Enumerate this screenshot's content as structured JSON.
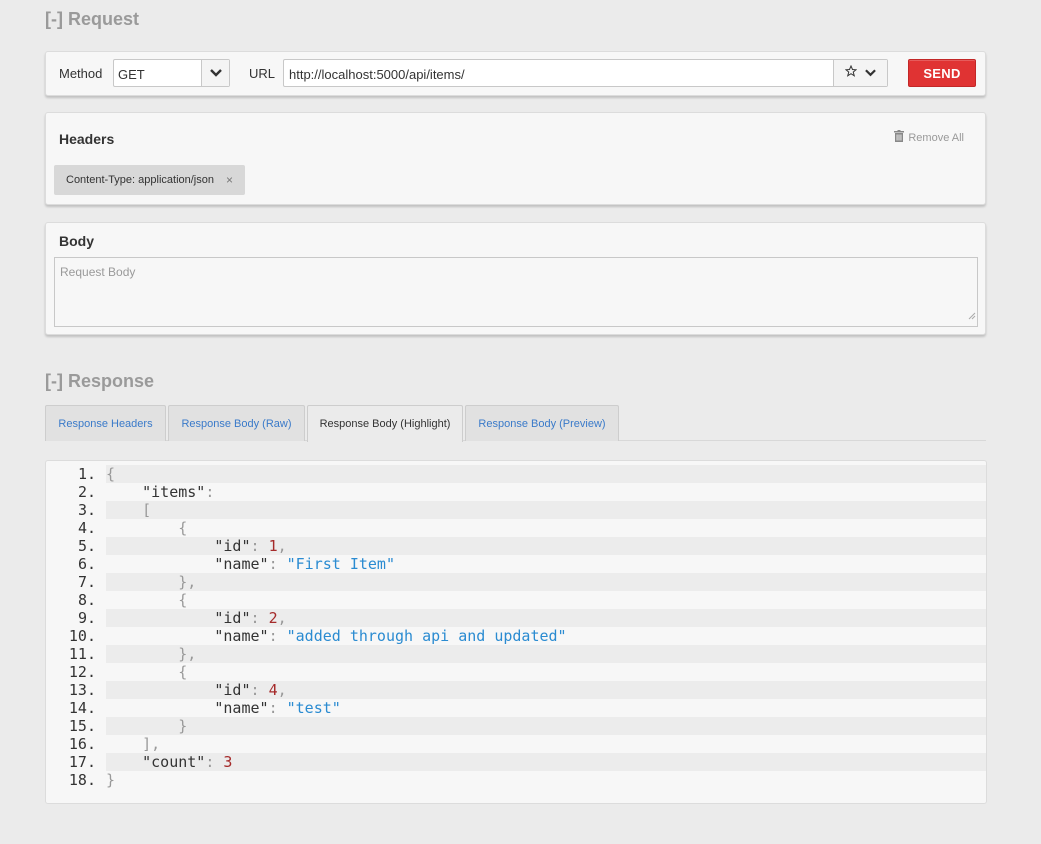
{
  "request": {
    "title": "[-] Request",
    "method_label": "Method",
    "method_value": "GET",
    "url_label": "URL",
    "url_value": "http://localhost:5000/api/items/",
    "send_label": "SEND",
    "headers": {
      "heading": "Headers",
      "remove_all": "Remove All",
      "items": [
        {
          "text": "Content-Type: application/json",
          "remove": "×"
        }
      ]
    },
    "body": {
      "heading": "Body",
      "placeholder": "Request Body"
    }
  },
  "response": {
    "title": "[-] Response",
    "tabs": [
      {
        "label": "Response Headers"
      },
      {
        "label": "Response Body (Raw)"
      },
      {
        "label": "Response Body (Highlight)",
        "active": true
      },
      {
        "label": "Response Body (Preview)"
      }
    ],
    "code_lines": [
      {
        "num": "1.",
        "tokens": [
          [
            "p",
            "{"
          ]
        ]
      },
      {
        "num": "2.",
        "tokens": [
          [
            "k",
            "    \"items\""
          ],
          [
            "p",
            ":"
          ]
        ]
      },
      {
        "num": "3.",
        "tokens": [
          [
            "p",
            "    ["
          ]
        ]
      },
      {
        "num": "4.",
        "tokens": [
          [
            "p",
            "        {"
          ]
        ]
      },
      {
        "num": "5.",
        "tokens": [
          [
            "k",
            "            \"id\""
          ],
          [
            "p",
            ": "
          ],
          [
            "n",
            "1"
          ],
          [
            "p",
            ","
          ]
        ]
      },
      {
        "num": "6.",
        "tokens": [
          [
            "k",
            "            \"name\""
          ],
          [
            "p",
            ": "
          ],
          [
            "s",
            "\"First Item\""
          ]
        ]
      },
      {
        "num": "7.",
        "tokens": [
          [
            "p",
            "        },"
          ]
        ]
      },
      {
        "num": "8.",
        "tokens": [
          [
            "p",
            "        {"
          ]
        ]
      },
      {
        "num": "9.",
        "tokens": [
          [
            "k",
            "            \"id\""
          ],
          [
            "p",
            ": "
          ],
          [
            "n",
            "2"
          ],
          [
            "p",
            ","
          ]
        ]
      },
      {
        "num": "10.",
        "tokens": [
          [
            "k",
            "            \"name\""
          ],
          [
            "p",
            ": "
          ],
          [
            "s",
            "\"added through api and updated\""
          ]
        ]
      },
      {
        "num": "11.",
        "tokens": [
          [
            "p",
            "        },"
          ]
        ]
      },
      {
        "num": "12.",
        "tokens": [
          [
            "p",
            "        {"
          ]
        ]
      },
      {
        "num": "13.",
        "tokens": [
          [
            "k",
            "            \"id\""
          ],
          [
            "p",
            ": "
          ],
          [
            "n",
            "4"
          ],
          [
            "p",
            ","
          ]
        ]
      },
      {
        "num": "14.",
        "tokens": [
          [
            "k",
            "            \"name\""
          ],
          [
            "p",
            ": "
          ],
          [
            "s",
            "\"test\""
          ]
        ]
      },
      {
        "num": "15.",
        "tokens": [
          [
            "p",
            "        }"
          ]
        ]
      },
      {
        "num": "16.",
        "tokens": [
          [
            "p",
            "    ],"
          ]
        ]
      },
      {
        "num": "17.",
        "tokens": [
          [
            "k",
            "    \"count\""
          ],
          [
            "p",
            ": "
          ],
          [
            "n",
            "3"
          ]
        ]
      },
      {
        "num": "18.",
        "tokens": [
          [
            "p",
            "}"
          ]
        ]
      }
    ]
  },
  "icons": {
    "method_caret": "chevron-down-icon",
    "url_star": "star-icon",
    "url_caret": "chevron-down-icon",
    "remove_all": "trash-icon",
    "tag_remove": "close-icon",
    "resize": "resize-grip-icon"
  },
  "colors": {
    "send": "#e03333",
    "link": "#3a7ac9",
    "json_string": "#2a8bd1",
    "json_number": "#a52a2a"
  }
}
